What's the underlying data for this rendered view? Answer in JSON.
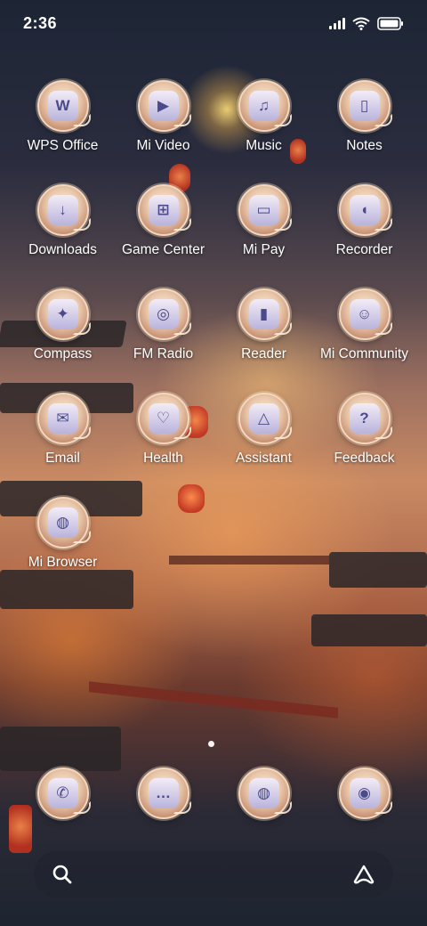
{
  "status_bar": {
    "time": "2:36"
  },
  "apps": [
    {
      "label": "WPS Office",
      "icon": "wps-office-icon",
      "glyph": "W"
    },
    {
      "label": "Mi Video",
      "icon": "play-icon",
      "glyph": "▶"
    },
    {
      "label": "Music",
      "icon": "music-note-icon",
      "glyph": "♫"
    },
    {
      "label": "Notes",
      "icon": "notes-icon",
      "glyph": "▯"
    },
    {
      "label": "Downloads",
      "icon": "download-icon",
      "glyph": "↓"
    },
    {
      "label": "Game Center",
      "icon": "gamepad-icon",
      "glyph": "⊞"
    },
    {
      "label": "Mi Pay",
      "icon": "wallet-icon",
      "glyph": "▭"
    },
    {
      "label": "Recorder",
      "icon": "microphone-icon",
      "glyph": "◖"
    },
    {
      "label": "Compass",
      "icon": "compass-icon",
      "glyph": "✦"
    },
    {
      "label": "FM Radio",
      "icon": "radio-icon",
      "glyph": "◎"
    },
    {
      "label": "Reader",
      "icon": "book-icon",
      "glyph": "▮"
    },
    {
      "label": "Mi Community",
      "icon": "community-icon",
      "glyph": "☺"
    },
    {
      "label": "Email",
      "icon": "envelope-icon",
      "glyph": "✉"
    },
    {
      "label": "Health",
      "icon": "health-icon",
      "glyph": "♡"
    },
    {
      "label": "Assistant",
      "icon": "assistant-icon",
      "glyph": "△"
    },
    {
      "label": "Feedback",
      "icon": "feedback-icon",
      "glyph": "?"
    },
    {
      "label": "Mi Browser",
      "icon": "globe-icon",
      "glyph": "◍"
    }
  ],
  "dock": [
    {
      "icon": "phone-icon",
      "glyph": "✆"
    },
    {
      "icon": "messages-icon",
      "glyph": "…"
    },
    {
      "icon": "browser-icon",
      "glyph": "◍"
    },
    {
      "icon": "camera-icon",
      "glyph": "◉"
    }
  ],
  "colors": {
    "label_text": "#ffffff",
    "icon_ring": "#f4d7bc",
    "icon_glyph": "#4b4a8a"
  }
}
